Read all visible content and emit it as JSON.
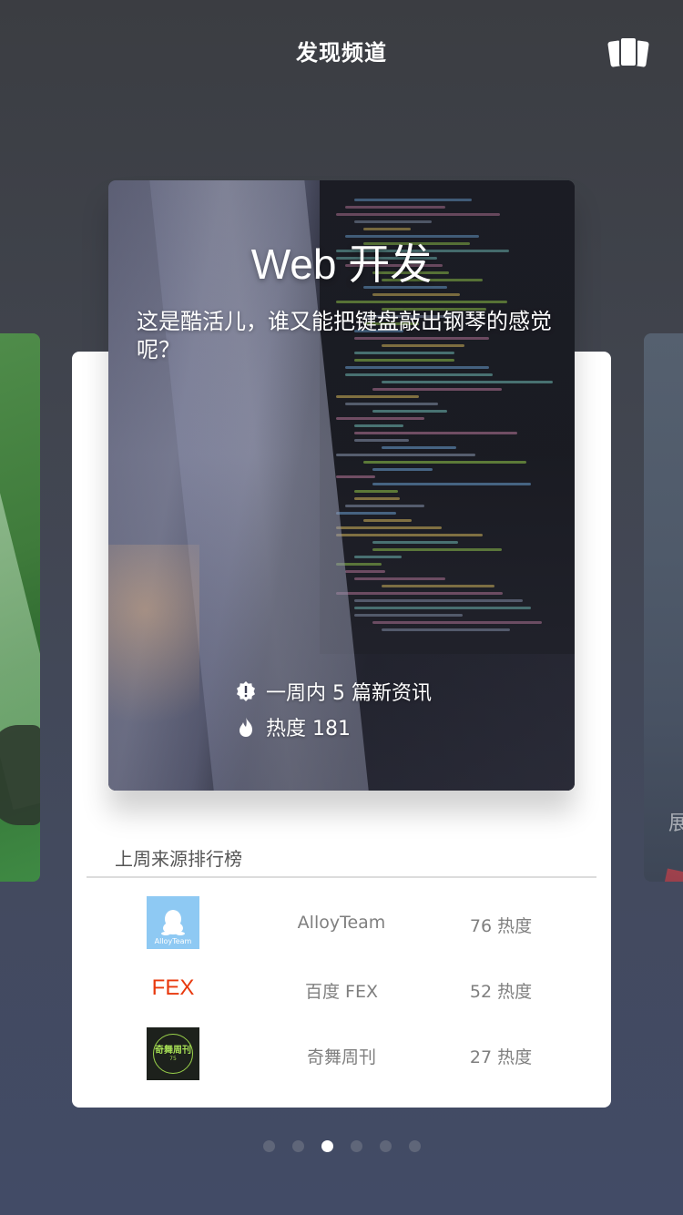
{
  "header": {
    "title": "发现频道",
    "cards_icon": "cards-stack-icon"
  },
  "featured": {
    "title": "Web 开发",
    "description": "这是酷活儿，谁又能把键盘敲出钢琴的感觉呢？",
    "stats": [
      {
        "icon": "badge-alert-icon",
        "text": "一周内 5 篇新资讯"
      },
      {
        "icon": "flame-icon",
        "text": "热度 181"
      }
    ]
  },
  "right_peek": {
    "text": "展"
  },
  "ranking": {
    "title": "上周来源排行榜",
    "rows": [
      {
        "logo": "alloyteam-logo",
        "logo_caption": "AlloyTeam",
        "name": "AlloyTeam",
        "heat": "76 热度"
      },
      {
        "logo": "fex-logo",
        "logo_text": "FEX",
        "name": "百度 FEX",
        "heat": "52 热度"
      },
      {
        "logo": "qiwu-logo",
        "logo_text": "奇舞周刊",
        "logo_sub": "75",
        "name": "奇舞周刊",
        "heat": "27 热度"
      }
    ]
  },
  "pagination": {
    "total": 6,
    "current": 3
  },
  "colors": {
    "accent_white": "#ffffff",
    "fex_red": "#e8390e",
    "alloy_blue": "#8ec9f3",
    "qiwu_green": "#a6de55",
    "muted_text": "#7f7f7f"
  }
}
